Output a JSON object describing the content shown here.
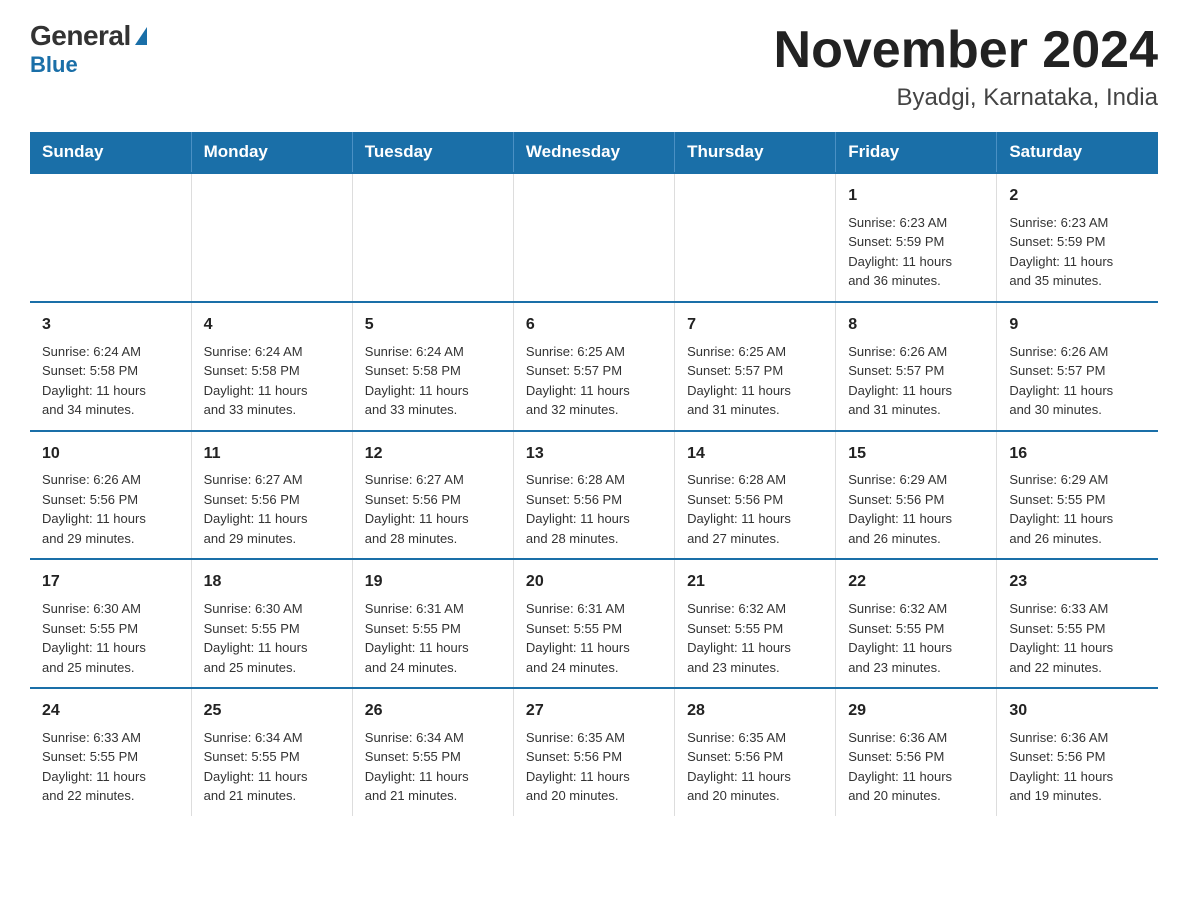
{
  "logo": {
    "general": "General",
    "blue": "Blue"
  },
  "title": {
    "month_year": "November 2024",
    "location": "Byadgi, Karnataka, India"
  },
  "days_of_week": [
    "Sunday",
    "Monday",
    "Tuesday",
    "Wednesday",
    "Thursday",
    "Friday",
    "Saturday"
  ],
  "weeks": [
    {
      "days": [
        {
          "num": "",
          "info": ""
        },
        {
          "num": "",
          "info": ""
        },
        {
          "num": "",
          "info": ""
        },
        {
          "num": "",
          "info": ""
        },
        {
          "num": "",
          "info": ""
        },
        {
          "num": "1",
          "info": "Sunrise: 6:23 AM\nSunset: 5:59 PM\nDaylight: 11 hours\nand 36 minutes."
        },
        {
          "num": "2",
          "info": "Sunrise: 6:23 AM\nSunset: 5:59 PM\nDaylight: 11 hours\nand 35 minutes."
        }
      ]
    },
    {
      "days": [
        {
          "num": "3",
          "info": "Sunrise: 6:24 AM\nSunset: 5:58 PM\nDaylight: 11 hours\nand 34 minutes."
        },
        {
          "num": "4",
          "info": "Sunrise: 6:24 AM\nSunset: 5:58 PM\nDaylight: 11 hours\nand 33 minutes."
        },
        {
          "num": "5",
          "info": "Sunrise: 6:24 AM\nSunset: 5:58 PM\nDaylight: 11 hours\nand 33 minutes."
        },
        {
          "num": "6",
          "info": "Sunrise: 6:25 AM\nSunset: 5:57 PM\nDaylight: 11 hours\nand 32 minutes."
        },
        {
          "num": "7",
          "info": "Sunrise: 6:25 AM\nSunset: 5:57 PM\nDaylight: 11 hours\nand 31 minutes."
        },
        {
          "num": "8",
          "info": "Sunrise: 6:26 AM\nSunset: 5:57 PM\nDaylight: 11 hours\nand 31 minutes."
        },
        {
          "num": "9",
          "info": "Sunrise: 6:26 AM\nSunset: 5:57 PM\nDaylight: 11 hours\nand 30 minutes."
        }
      ]
    },
    {
      "days": [
        {
          "num": "10",
          "info": "Sunrise: 6:26 AM\nSunset: 5:56 PM\nDaylight: 11 hours\nand 29 minutes."
        },
        {
          "num": "11",
          "info": "Sunrise: 6:27 AM\nSunset: 5:56 PM\nDaylight: 11 hours\nand 29 minutes."
        },
        {
          "num": "12",
          "info": "Sunrise: 6:27 AM\nSunset: 5:56 PM\nDaylight: 11 hours\nand 28 minutes."
        },
        {
          "num": "13",
          "info": "Sunrise: 6:28 AM\nSunset: 5:56 PM\nDaylight: 11 hours\nand 28 minutes."
        },
        {
          "num": "14",
          "info": "Sunrise: 6:28 AM\nSunset: 5:56 PM\nDaylight: 11 hours\nand 27 minutes."
        },
        {
          "num": "15",
          "info": "Sunrise: 6:29 AM\nSunset: 5:56 PM\nDaylight: 11 hours\nand 26 minutes."
        },
        {
          "num": "16",
          "info": "Sunrise: 6:29 AM\nSunset: 5:55 PM\nDaylight: 11 hours\nand 26 minutes."
        }
      ]
    },
    {
      "days": [
        {
          "num": "17",
          "info": "Sunrise: 6:30 AM\nSunset: 5:55 PM\nDaylight: 11 hours\nand 25 minutes."
        },
        {
          "num": "18",
          "info": "Sunrise: 6:30 AM\nSunset: 5:55 PM\nDaylight: 11 hours\nand 25 minutes."
        },
        {
          "num": "19",
          "info": "Sunrise: 6:31 AM\nSunset: 5:55 PM\nDaylight: 11 hours\nand 24 minutes."
        },
        {
          "num": "20",
          "info": "Sunrise: 6:31 AM\nSunset: 5:55 PM\nDaylight: 11 hours\nand 24 minutes."
        },
        {
          "num": "21",
          "info": "Sunrise: 6:32 AM\nSunset: 5:55 PM\nDaylight: 11 hours\nand 23 minutes."
        },
        {
          "num": "22",
          "info": "Sunrise: 6:32 AM\nSunset: 5:55 PM\nDaylight: 11 hours\nand 23 minutes."
        },
        {
          "num": "23",
          "info": "Sunrise: 6:33 AM\nSunset: 5:55 PM\nDaylight: 11 hours\nand 22 minutes."
        }
      ]
    },
    {
      "days": [
        {
          "num": "24",
          "info": "Sunrise: 6:33 AM\nSunset: 5:55 PM\nDaylight: 11 hours\nand 22 minutes."
        },
        {
          "num": "25",
          "info": "Sunrise: 6:34 AM\nSunset: 5:55 PM\nDaylight: 11 hours\nand 21 minutes."
        },
        {
          "num": "26",
          "info": "Sunrise: 6:34 AM\nSunset: 5:55 PM\nDaylight: 11 hours\nand 21 minutes."
        },
        {
          "num": "27",
          "info": "Sunrise: 6:35 AM\nSunset: 5:56 PM\nDaylight: 11 hours\nand 20 minutes."
        },
        {
          "num": "28",
          "info": "Sunrise: 6:35 AM\nSunset: 5:56 PM\nDaylight: 11 hours\nand 20 minutes."
        },
        {
          "num": "29",
          "info": "Sunrise: 6:36 AM\nSunset: 5:56 PM\nDaylight: 11 hours\nand 20 minutes."
        },
        {
          "num": "30",
          "info": "Sunrise: 6:36 AM\nSunset: 5:56 PM\nDaylight: 11 hours\nand 19 minutes."
        }
      ]
    }
  ]
}
